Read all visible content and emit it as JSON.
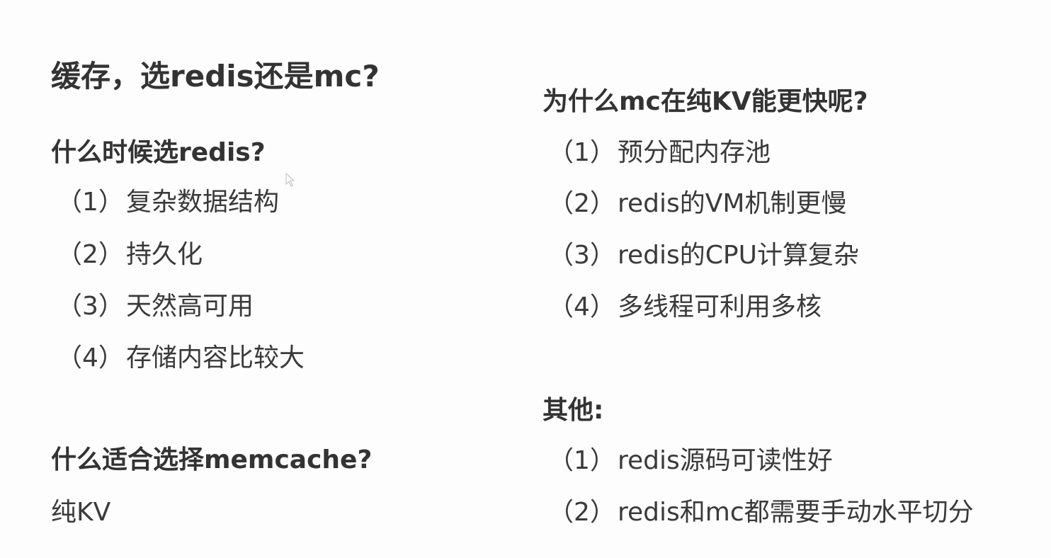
{
  "left": {
    "title": "缓存，选redis还是mc?",
    "redis_heading": "什么时候选redis?",
    "redis_items": [
      {
        "num": "（1）",
        "text": "复杂数据结构"
      },
      {
        "num": "（2）",
        "text": "持久化"
      },
      {
        "num": "（3）",
        "text": "天然高可用"
      },
      {
        "num": "（4）",
        "text": "存储内容比较大"
      }
    ],
    "mc_heading": "什么适合选择memcache?",
    "mc_text": "纯KV"
  },
  "right": {
    "why_heading": "为什么mc在纯KV能更快呢?",
    "why_items": [
      {
        "num": "（1）",
        "text": "预分配内存池"
      },
      {
        "num": "（2）",
        "text": "redis的VM机制更慢"
      },
      {
        "num": "（3）",
        "text": "redis的CPU计算复杂"
      },
      {
        "num": "（4）",
        "text": "多线程可利用多核"
      }
    ],
    "other_heading": "其他:",
    "other_items": [
      {
        "num": "（1）",
        "text": "redis源码可读性好"
      },
      {
        "num": "（2）",
        "text": "redis和mc都需要手动水平切分"
      }
    ]
  }
}
